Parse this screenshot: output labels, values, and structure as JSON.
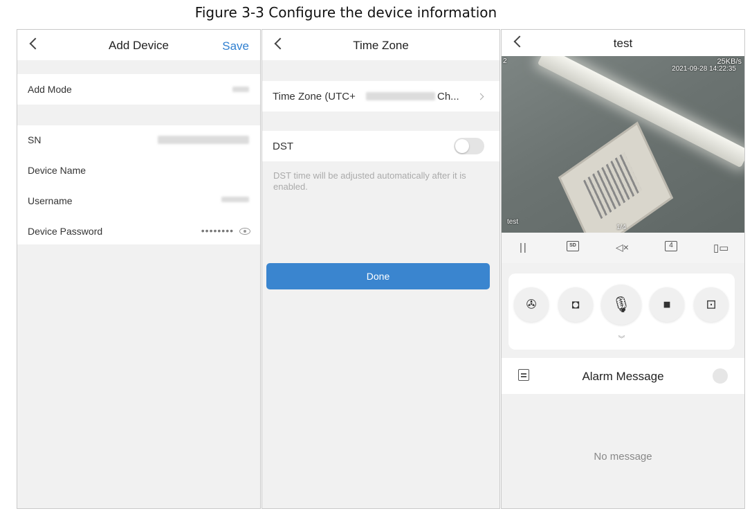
{
  "caption": "Figure 3-3 Configure the device information",
  "add_device": {
    "title": "Add Device",
    "save_label": "Save",
    "rows": {
      "add_mode": "Add Mode",
      "sn": "SN",
      "device_name": "Device Name",
      "username": "Username",
      "device_password": "Device Password"
    },
    "password_mask": "••••••••"
  },
  "time_zone": {
    "title": "Time Zone",
    "tz_label": "Time Zone",
    "tz_value_prefix": "(UTC+",
    "tz_value_suffix": "Ch...",
    "dst_label": "DST",
    "dst_enabled": false,
    "dst_hint": "DST time will be adjusted automatically after it is enabled.",
    "done_label": "Done"
  },
  "live": {
    "title": "test",
    "overlay": {
      "bitrate": "25KB/s",
      "timestamp": "2021-09-28 14:22:35",
      "channel_name": "test",
      "page": "1/4",
      "corner_digit": "2"
    },
    "controls": {
      "pause": "||",
      "quality": "SD",
      "mute": "◁×",
      "split": "4"
    },
    "alarm_title": "Alarm Message",
    "empty_text": "No message"
  },
  "colors": {
    "accent": "#2f7fd0",
    "done_button": "#3a85cf",
    "panel_bg": "#f1f1f1"
  }
}
